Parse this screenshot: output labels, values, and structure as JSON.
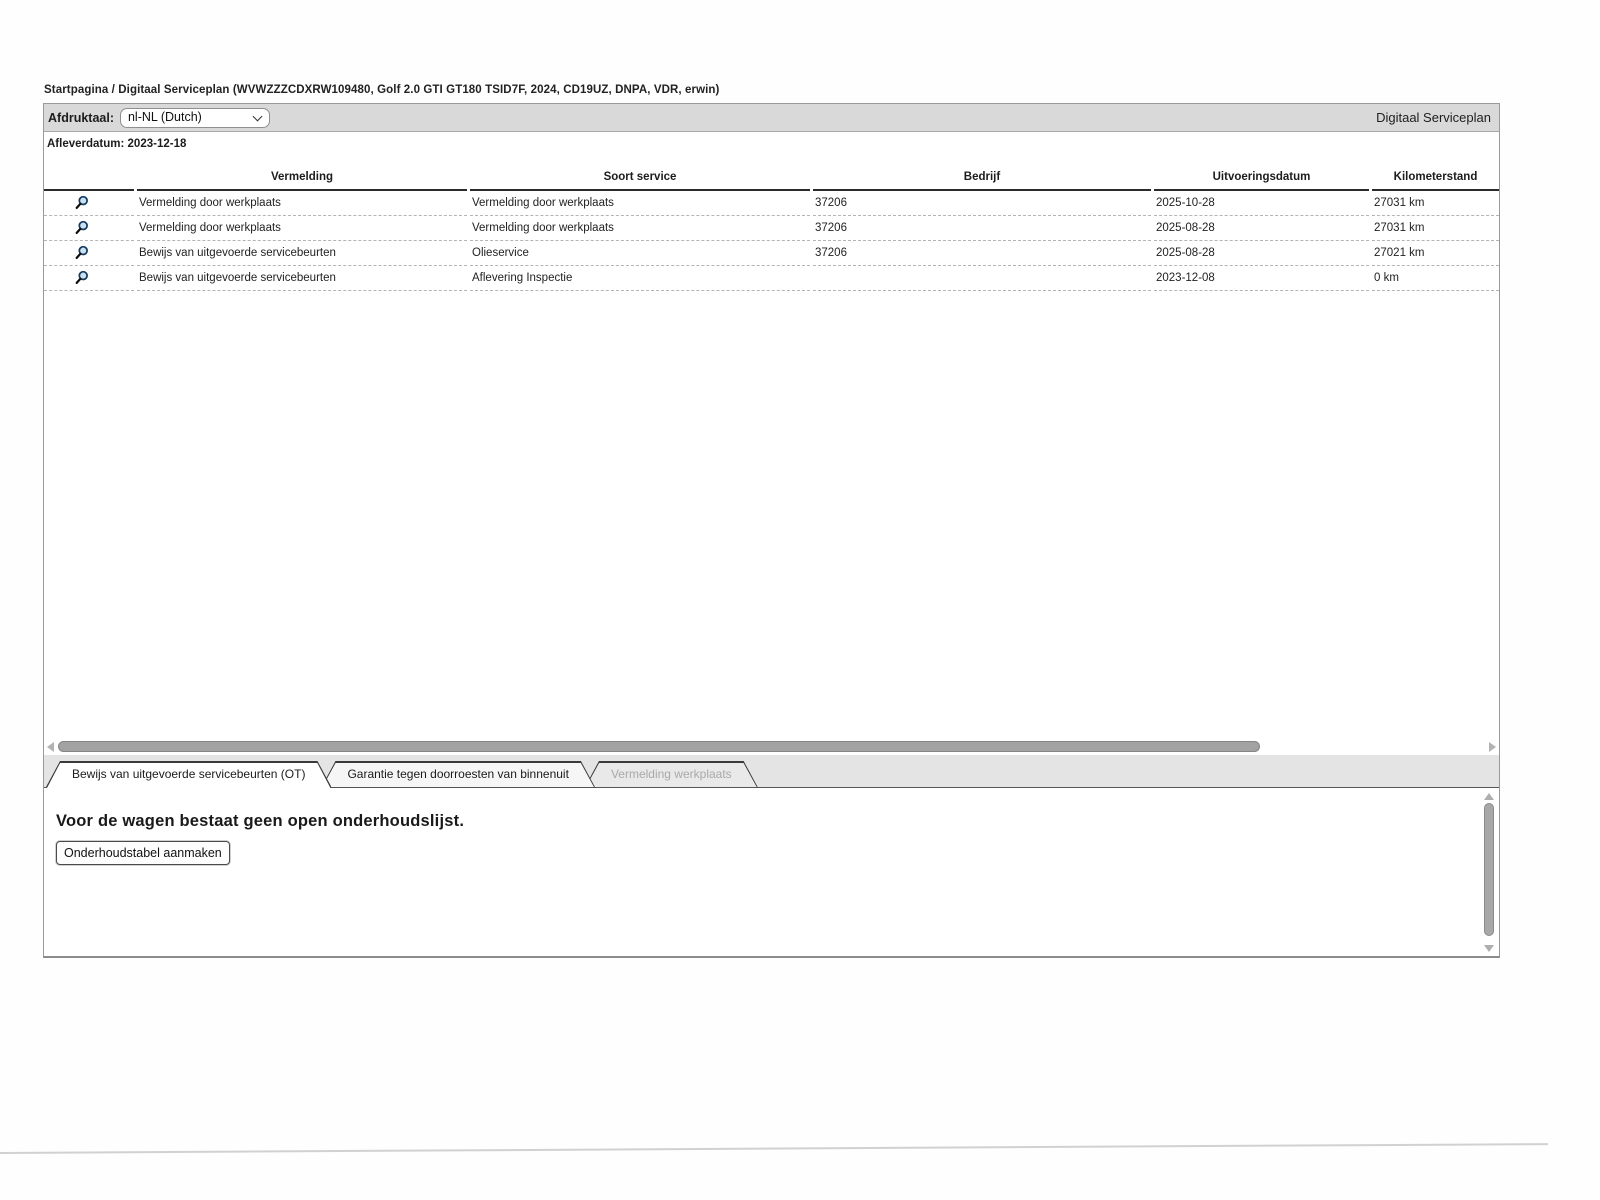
{
  "page": {
    "breadcrumb": "Startpagina / Digitaal Serviceplan (WVWZZZCDXRW109480, Golf 2.0 GTI GT180 TSID7F, 2024, CD19UZ, DNPA, VDR, erwin)",
    "title": "Digitaal Serviceplan"
  },
  "print_language": {
    "label": "Afdruktaal:",
    "selected": "nl-NL (Dutch)"
  },
  "delivery_date": {
    "label": "Afleverdatum:",
    "value": "2023-12-18"
  },
  "table": {
    "columns": [
      "Vermelding",
      "Soort service",
      "Bedrijf",
      "Uitvoeringsdatum",
      "Kilometerstand"
    ],
    "rows": [
      {
        "icon": "magnifier-icon",
        "vermelding": "Vermelding door werkplaats",
        "soort_service": "Vermelding door werkplaats",
        "bedrijf": "37206",
        "uitvoeringsdatum": "2025-10-28",
        "kilometerstand": "27031 km"
      },
      {
        "icon": "magnifier-icon",
        "vermelding": "Vermelding door werkplaats",
        "soort_service": "Vermelding door werkplaats",
        "bedrijf": "37206",
        "uitvoeringsdatum": "2025-08-28",
        "kilometerstand": "27031 km"
      },
      {
        "icon": "magnifier-icon",
        "vermelding": "Bewijs van uitgevoerde servicebeurten",
        "soort_service": "Olieservice",
        "bedrijf": "37206",
        "uitvoeringsdatum": "2025-08-28",
        "kilometerstand": "27021 km"
      },
      {
        "icon": "magnifier-icon",
        "vermelding": "Bewijs van uitgevoerde servicebeurten",
        "soort_service": "Aflevering Inspectie",
        "bedrijf": "",
        "uitvoeringsdatum": "2023-12-08",
        "kilometerstand": "0 km"
      }
    ]
  },
  "tabs": [
    {
      "label": "Bewijs van uitgevoerde servicebeurten (OT)",
      "state": "active"
    },
    {
      "label": "Garantie tegen doorroesten van binnenuit",
      "state": "normal"
    },
    {
      "label": "Vermelding werkplaats",
      "state": "disabled"
    }
  ],
  "panel": {
    "message": "Voor de wagen bestaat geen open onderhoudslijst.",
    "button_label": "Onderhoudstabel aanmaken"
  },
  "icons": {
    "row_icon": "magnifier-icon",
    "select_icon": "chevron-down-icon"
  },
  "colors": {
    "header_bar": "#d9d9d9",
    "tab_strip": "#e4e4e4",
    "magnifier_lens": "#c7e2f2",
    "magnifier_rim": "#14395e",
    "scrollbar_thumb": "#a2a2a2"
  }
}
